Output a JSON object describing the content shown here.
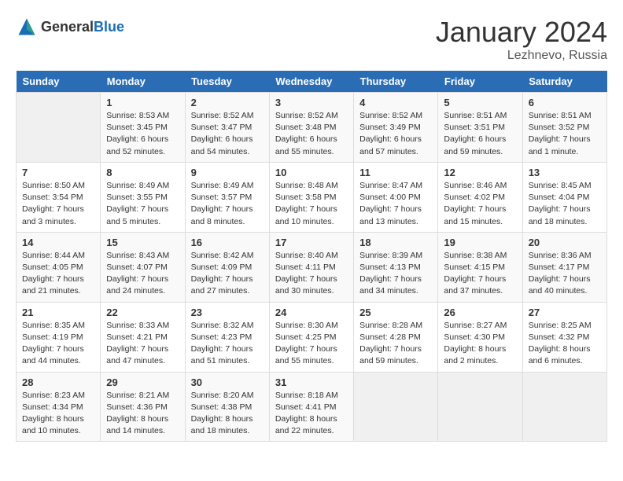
{
  "header": {
    "logo_general": "General",
    "logo_blue": "Blue",
    "month_year": "January 2024",
    "location": "Lezhnevo, Russia"
  },
  "days_of_week": [
    "Sunday",
    "Monday",
    "Tuesday",
    "Wednesday",
    "Thursday",
    "Friday",
    "Saturday"
  ],
  "weeks": [
    [
      {
        "day": "",
        "info": ""
      },
      {
        "day": "1",
        "info": "Sunrise: 8:53 AM\nSunset: 3:45 PM\nDaylight: 6 hours\nand 52 minutes."
      },
      {
        "day": "2",
        "info": "Sunrise: 8:52 AM\nSunset: 3:47 PM\nDaylight: 6 hours\nand 54 minutes."
      },
      {
        "day": "3",
        "info": "Sunrise: 8:52 AM\nSunset: 3:48 PM\nDaylight: 6 hours\nand 55 minutes."
      },
      {
        "day": "4",
        "info": "Sunrise: 8:52 AM\nSunset: 3:49 PM\nDaylight: 6 hours\nand 57 minutes."
      },
      {
        "day": "5",
        "info": "Sunrise: 8:51 AM\nSunset: 3:51 PM\nDaylight: 6 hours\nand 59 minutes."
      },
      {
        "day": "6",
        "info": "Sunrise: 8:51 AM\nSunset: 3:52 PM\nDaylight: 7 hours\nand 1 minute."
      }
    ],
    [
      {
        "day": "7",
        "info": "Sunrise: 8:50 AM\nSunset: 3:54 PM\nDaylight: 7 hours\nand 3 minutes."
      },
      {
        "day": "8",
        "info": "Sunrise: 8:49 AM\nSunset: 3:55 PM\nDaylight: 7 hours\nand 5 minutes."
      },
      {
        "day": "9",
        "info": "Sunrise: 8:49 AM\nSunset: 3:57 PM\nDaylight: 7 hours\nand 8 minutes."
      },
      {
        "day": "10",
        "info": "Sunrise: 8:48 AM\nSunset: 3:58 PM\nDaylight: 7 hours\nand 10 minutes."
      },
      {
        "day": "11",
        "info": "Sunrise: 8:47 AM\nSunset: 4:00 PM\nDaylight: 7 hours\nand 13 minutes."
      },
      {
        "day": "12",
        "info": "Sunrise: 8:46 AM\nSunset: 4:02 PM\nDaylight: 7 hours\nand 15 minutes."
      },
      {
        "day": "13",
        "info": "Sunrise: 8:45 AM\nSunset: 4:04 PM\nDaylight: 7 hours\nand 18 minutes."
      }
    ],
    [
      {
        "day": "14",
        "info": "Sunrise: 8:44 AM\nSunset: 4:05 PM\nDaylight: 7 hours\nand 21 minutes."
      },
      {
        "day": "15",
        "info": "Sunrise: 8:43 AM\nSunset: 4:07 PM\nDaylight: 7 hours\nand 24 minutes."
      },
      {
        "day": "16",
        "info": "Sunrise: 8:42 AM\nSunset: 4:09 PM\nDaylight: 7 hours\nand 27 minutes."
      },
      {
        "day": "17",
        "info": "Sunrise: 8:40 AM\nSunset: 4:11 PM\nDaylight: 7 hours\nand 30 minutes."
      },
      {
        "day": "18",
        "info": "Sunrise: 8:39 AM\nSunset: 4:13 PM\nDaylight: 7 hours\nand 34 minutes."
      },
      {
        "day": "19",
        "info": "Sunrise: 8:38 AM\nSunset: 4:15 PM\nDaylight: 7 hours\nand 37 minutes."
      },
      {
        "day": "20",
        "info": "Sunrise: 8:36 AM\nSunset: 4:17 PM\nDaylight: 7 hours\nand 40 minutes."
      }
    ],
    [
      {
        "day": "21",
        "info": "Sunrise: 8:35 AM\nSunset: 4:19 PM\nDaylight: 7 hours\nand 44 minutes."
      },
      {
        "day": "22",
        "info": "Sunrise: 8:33 AM\nSunset: 4:21 PM\nDaylight: 7 hours\nand 47 minutes."
      },
      {
        "day": "23",
        "info": "Sunrise: 8:32 AM\nSunset: 4:23 PM\nDaylight: 7 hours\nand 51 minutes."
      },
      {
        "day": "24",
        "info": "Sunrise: 8:30 AM\nSunset: 4:25 PM\nDaylight: 7 hours\nand 55 minutes."
      },
      {
        "day": "25",
        "info": "Sunrise: 8:28 AM\nSunset: 4:28 PM\nDaylight: 7 hours\nand 59 minutes."
      },
      {
        "day": "26",
        "info": "Sunrise: 8:27 AM\nSunset: 4:30 PM\nDaylight: 8 hours\nand 2 minutes."
      },
      {
        "day": "27",
        "info": "Sunrise: 8:25 AM\nSunset: 4:32 PM\nDaylight: 8 hours\nand 6 minutes."
      }
    ],
    [
      {
        "day": "28",
        "info": "Sunrise: 8:23 AM\nSunset: 4:34 PM\nDaylight: 8 hours\nand 10 minutes."
      },
      {
        "day": "29",
        "info": "Sunrise: 8:21 AM\nSunset: 4:36 PM\nDaylight: 8 hours\nand 14 minutes."
      },
      {
        "day": "30",
        "info": "Sunrise: 8:20 AM\nSunset: 4:38 PM\nDaylight: 8 hours\nand 18 minutes."
      },
      {
        "day": "31",
        "info": "Sunrise: 8:18 AM\nSunset: 4:41 PM\nDaylight: 8 hours\nand 22 minutes."
      },
      {
        "day": "",
        "info": ""
      },
      {
        "day": "",
        "info": ""
      },
      {
        "day": "",
        "info": ""
      }
    ]
  ]
}
